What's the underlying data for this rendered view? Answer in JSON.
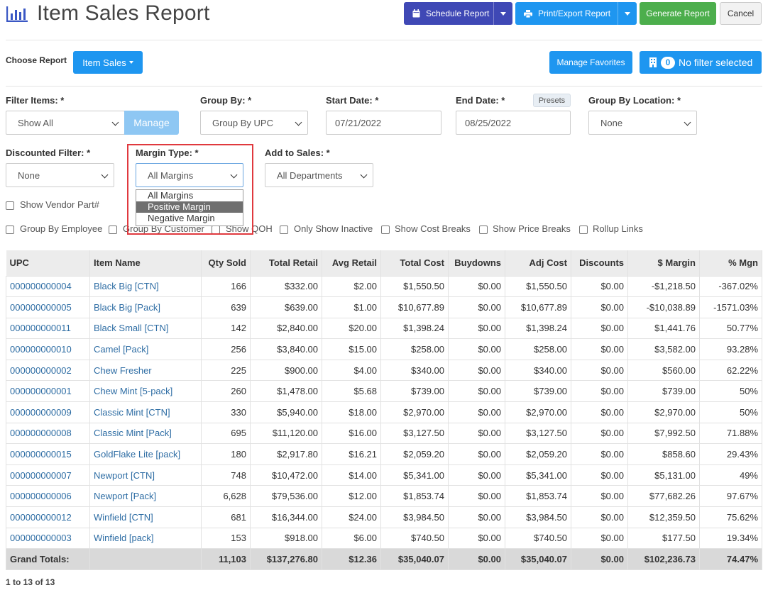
{
  "header": {
    "title": "Item Sales Report",
    "icon": "bar-chart-icon",
    "buttons": {
      "schedule": "Schedule Report",
      "print_export": "Print/Export Report",
      "generate": "Generate Report",
      "cancel": "Cancel"
    }
  },
  "report_bar": {
    "choose_label": "Choose Report",
    "report_selected": "Item Sales",
    "manage_favorites": "Manage Favorites",
    "filter_count": "0",
    "filter_text": "No filter selected"
  },
  "filters": {
    "filter_items": {
      "label": "Filter Items: *",
      "value": "Show All",
      "manage": "Manage"
    },
    "group_by": {
      "label": "Group By: *",
      "value": "Group By UPC"
    },
    "start_date": {
      "label": "Start Date: *",
      "value": "07/21/2022"
    },
    "end_date": {
      "label": "End Date: *",
      "value": "08/25/2022",
      "presets": "Presets"
    },
    "group_by_location": {
      "label": "Group By Location: *",
      "value": "None"
    },
    "discounted": {
      "label": "Discounted Filter: *",
      "value": "None"
    },
    "margin_type": {
      "label": "Margin Type: *",
      "value": "All Margins",
      "options": [
        "All Margins",
        "Positive Margin",
        "Negative Margin"
      ],
      "highlighted": "Positive Margin"
    },
    "add_to_sales": {
      "label": "Add to Sales: *",
      "value": "All Departments"
    }
  },
  "checkboxes": {
    "vendor_part": "Show Vendor Part#",
    "group_by_employee": "Group By Employee",
    "group_by_customer": "Group By Customer",
    "show_qoh": "Show QOH",
    "only_inactive": "Only Show Inactive",
    "cost_breaks": "Show Cost Breaks",
    "price_breaks": "Show Price Breaks",
    "rollup_links": "Rollup Links"
  },
  "table": {
    "columns": [
      "UPC",
      "Item Name",
      "Qty Sold",
      "Total Retail",
      "Avg Retail",
      "Total Cost",
      "Buydowns",
      "Adj Cost",
      "Discounts",
      "$ Margin",
      "% Mgn"
    ],
    "rows": [
      [
        "000000000004",
        "Black Big [CTN]",
        "166",
        "$332.00",
        "$2.00",
        "$1,550.50",
        "$0.00",
        "$1,550.50",
        "$0.00",
        "-$1,218.50",
        "-367.02%"
      ],
      [
        "000000000005",
        "Black Big [Pack]",
        "639",
        "$639.00",
        "$1.00",
        "$10,677.89",
        "$0.00",
        "$10,677.89",
        "$0.00",
        "-$10,038.89",
        "-1571.03%"
      ],
      [
        "000000000011",
        "Black Small [CTN]",
        "142",
        "$2,840.00",
        "$20.00",
        "$1,398.24",
        "$0.00",
        "$1,398.24",
        "$0.00",
        "$1,441.76",
        "50.77%"
      ],
      [
        "000000000010",
        "Camel [Pack]",
        "256",
        "$3,840.00",
        "$15.00",
        "$258.00",
        "$0.00",
        "$258.00",
        "$0.00",
        "$3,582.00",
        "93.28%"
      ],
      [
        "000000000002",
        "Chew Fresher",
        "225",
        "$900.00",
        "$4.00",
        "$340.00",
        "$0.00",
        "$340.00",
        "$0.00",
        "$560.00",
        "62.22%"
      ],
      [
        "000000000001",
        "Chew Mint [5-pack]",
        "260",
        "$1,478.00",
        "$5.68",
        "$739.00",
        "$0.00",
        "$739.00",
        "$0.00",
        "$739.00",
        "50%"
      ],
      [
        "000000000009",
        "Classic Mint [CTN]",
        "330",
        "$5,940.00",
        "$18.00",
        "$2,970.00",
        "$0.00",
        "$2,970.00",
        "$0.00",
        "$2,970.00",
        "50%"
      ],
      [
        "000000000008",
        "Classic Mint [Pack]",
        "695",
        "$11,120.00",
        "$16.00",
        "$3,127.50",
        "$0.00",
        "$3,127.50",
        "$0.00",
        "$7,992.50",
        "71.88%"
      ],
      [
        "000000000015",
        "GoldFlake Lite [pack]",
        "180",
        "$2,917.80",
        "$16.21",
        "$2,059.20",
        "$0.00",
        "$2,059.20",
        "$0.00",
        "$858.60",
        "29.43%"
      ],
      [
        "000000000007",
        "Newport [CTN]",
        "748",
        "$10,472.00",
        "$14.00",
        "$5,341.00",
        "$0.00",
        "$5,341.00",
        "$0.00",
        "$5,131.00",
        "49%"
      ],
      [
        "000000000006",
        "Newport [Pack]",
        "6,628",
        "$79,536.00",
        "$12.00",
        "$1,853.74",
        "$0.00",
        "$1,853.74",
        "$0.00",
        "$77,682.26",
        "97.67%"
      ],
      [
        "000000000012",
        "Winfield [CTN]",
        "681",
        "$16,344.00",
        "$24.00",
        "$3,984.50",
        "$0.00",
        "$3,984.50",
        "$0.00",
        "$12,359.50",
        "75.62%"
      ],
      [
        "000000000003",
        "Winfield [pack]",
        "153",
        "$918.00",
        "$6.00",
        "$740.50",
        "$0.00",
        "$740.50",
        "$0.00",
        "$177.50",
        "19.34%"
      ]
    ],
    "totals": [
      "Grand Totals:",
      "",
      "11,103",
      "$137,276.80",
      "$12.36",
      "$35,040.07",
      "$0.00",
      "$35,040.07",
      "$0.00",
      "$102,236.73",
      "74.47%"
    ]
  },
  "pagination": "1 to 13 of 13",
  "colors": {
    "schedule_btn": "#3f48b5",
    "blue_btn": "#1e96f0",
    "generate_btn": "#4cae4c",
    "link": "#2e6da4",
    "highlight_border": "#e0393e"
  }
}
